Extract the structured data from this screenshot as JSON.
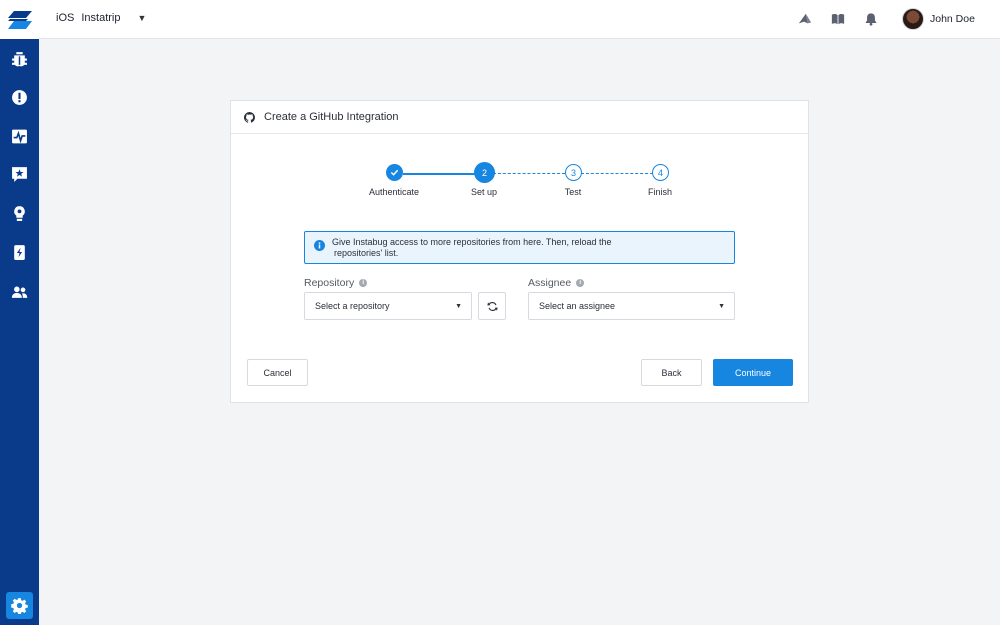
{
  "topbar": {
    "platform": "iOS",
    "app_name": "Instatrip",
    "user_name": "John Doe"
  },
  "sidebar": {
    "items": [
      {
        "icon": "bug-icon"
      },
      {
        "icon": "crash-icon"
      },
      {
        "icon": "performance-icon"
      },
      {
        "icon": "feedback-icon"
      },
      {
        "icon": "feature-request-icon"
      },
      {
        "icon": "app-apm-icon"
      },
      {
        "icon": "team-icon"
      },
      {
        "icon": "settings-icon"
      }
    ]
  },
  "card": {
    "title": "Create a GitHub Integration",
    "steps": [
      {
        "label": "Authenticate",
        "number": "",
        "state": "done"
      },
      {
        "label": "Set up",
        "number": "2",
        "state": "active"
      },
      {
        "label": "Test",
        "number": "3",
        "state": "todo"
      },
      {
        "label": "Finish",
        "number": "4",
        "state": "todo"
      }
    ],
    "info_line1": "Give Instabug access to more repositories from here. Then, reload the",
    "info_line2": "repositories' list.",
    "repository_label": "Repository",
    "repository_placeholder": "Select a repository",
    "assignee_label": "Assignee",
    "assignee_placeholder": "Select an assignee",
    "cancel_label": "Cancel",
    "back_label": "Back",
    "continue_label": "Continue"
  },
  "colors": {
    "sidebar": "#0a3a8a",
    "accent": "#1686e0",
    "background": "#f3f4f6"
  }
}
